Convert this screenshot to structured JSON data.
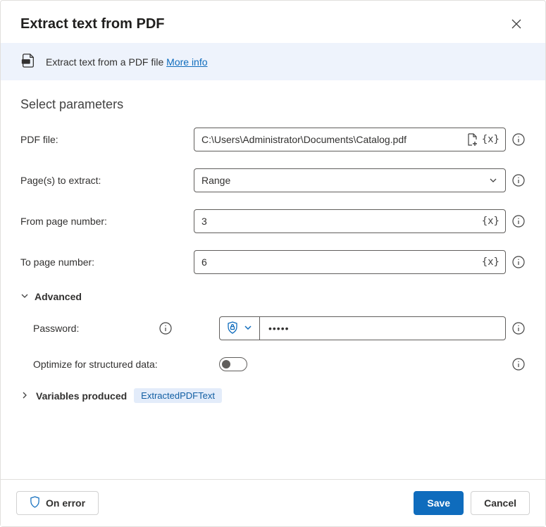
{
  "header": {
    "title": "Extract text from PDF"
  },
  "info": {
    "text": "Extract text from a PDF file ",
    "more_label": "More info"
  },
  "section_title": "Select parameters",
  "fields": {
    "pdf_file": {
      "label": "PDF file:",
      "value": "C:\\Users\\Administrator\\Documents\\Catalog.pdf"
    },
    "pages_to_extract": {
      "label": "Page(s) to extract:",
      "value": "Range"
    },
    "from_page": {
      "label": "From page number:",
      "value": "3"
    },
    "to_page": {
      "label": "To page number:",
      "value": "6"
    }
  },
  "advanced": {
    "heading": "Advanced",
    "password": {
      "label": "Password:",
      "value": "•••••"
    },
    "optimize": {
      "label": "Optimize for structured data:",
      "value": false
    }
  },
  "variables": {
    "heading": "Variables produced",
    "tag": "ExtractedPDFText"
  },
  "footer": {
    "on_error": "On error",
    "save": "Save",
    "cancel": "Cancel"
  },
  "glyphs": {
    "var_x": "{x}"
  }
}
